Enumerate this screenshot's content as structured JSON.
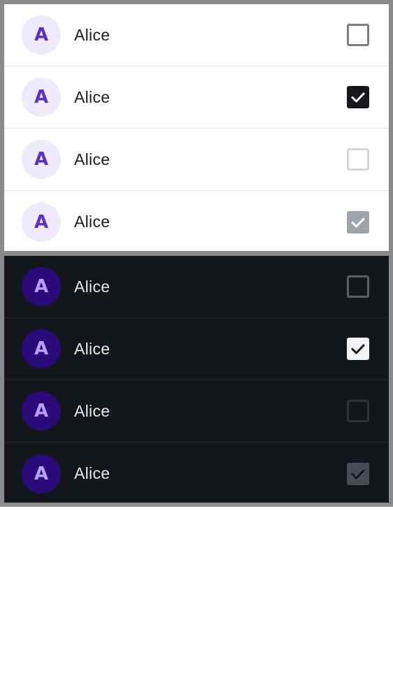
{
  "light_list": {
    "items": [
      {
        "avatar": "A",
        "name": "Alice",
        "state": "unchecked"
      },
      {
        "avatar": "A",
        "name": "Alice",
        "state": "checked"
      },
      {
        "avatar": "A",
        "name": "Alice",
        "state": "unchecked-disabled"
      },
      {
        "avatar": "A",
        "name": "Alice",
        "state": "checked-disabled"
      }
    ]
  },
  "dark_list": {
    "items": [
      {
        "avatar": "A",
        "name": "Alice",
        "state": "unchecked"
      },
      {
        "avatar": "A",
        "name": "Alice",
        "state": "checked"
      },
      {
        "avatar": "A",
        "name": "Alice",
        "state": "unchecked-disabled"
      },
      {
        "avatar": "A",
        "name": "Alice",
        "state": "checked-disabled"
      }
    ]
  },
  "colors": {
    "light_avatar_bg": "#efeafb",
    "light_avatar_text": "#5b2fc7",
    "dark_avatar_bg": "#2b0a7a",
    "dark_avatar_text": "#b7a3ff",
    "dark_panel_bg": "#13161b",
    "frame_border": "#8a8a8a"
  }
}
